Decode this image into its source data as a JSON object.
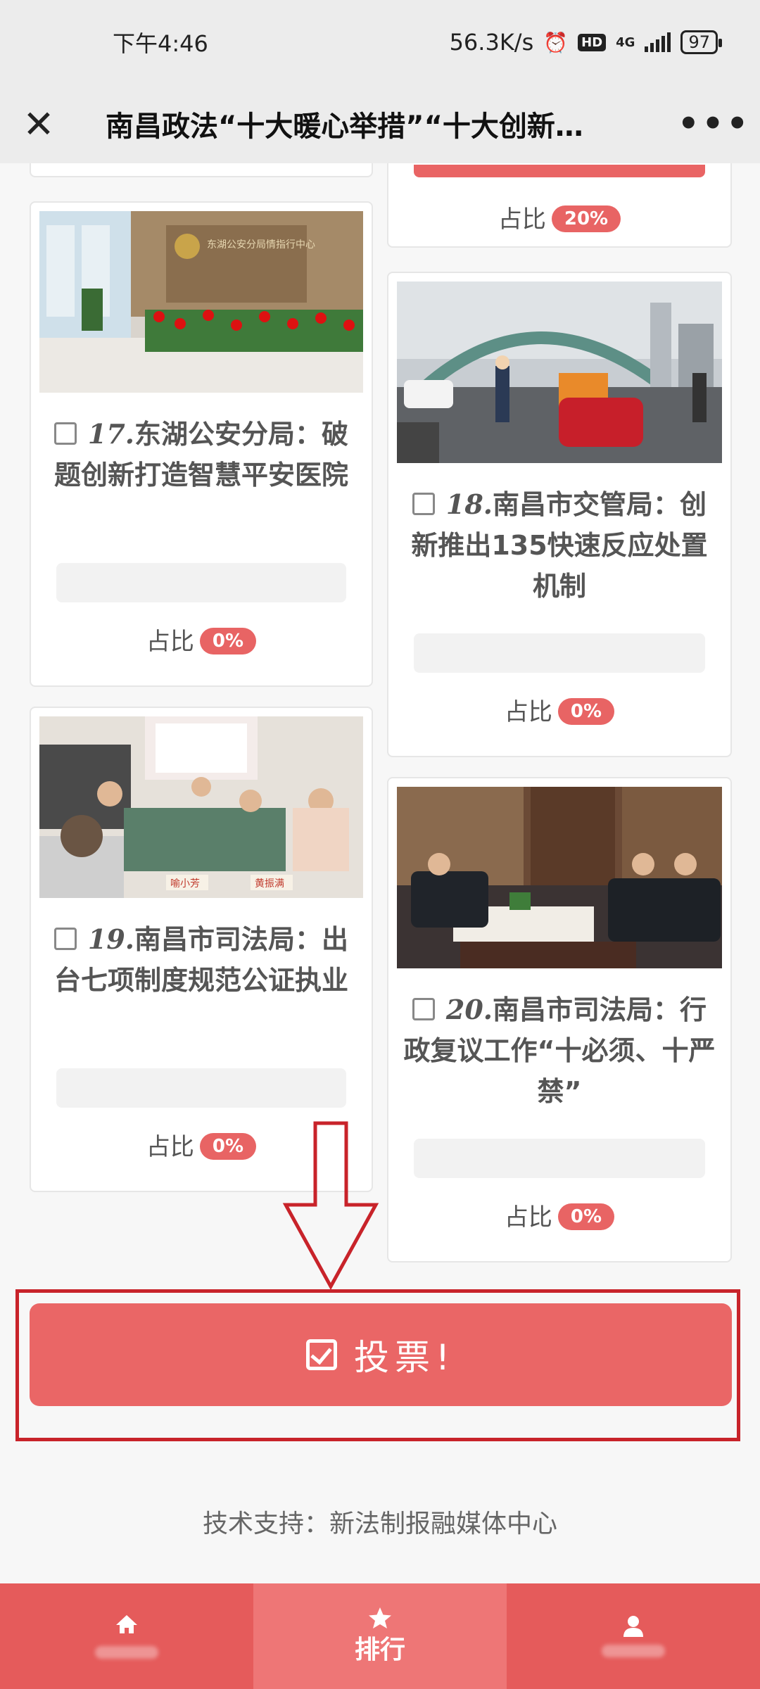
{
  "status_bar": {
    "time": "下午4:46",
    "net_speed": "56.3K/s",
    "hd": "HD",
    "network": "4G",
    "battery": "97"
  },
  "title_bar": {
    "title": "南昌政法“十大暖心举措”“十大创新…",
    "more": "•••",
    "close": "✕"
  },
  "partial_top": {
    "label": "占比",
    "percent": "20%"
  },
  "cards": [
    {
      "num": "17.",
      "title": "东湖公安分局：破题创新打造智慧平安医院",
      "label": "占比",
      "percent": "0%",
      "fill": 0,
      "sign_text": "东湖公安分局情指行中心"
    },
    {
      "num": "18.",
      "title": "南昌市交管局：创新推出135快速反应处置机制",
      "label": "占比",
      "percent": "0%",
      "fill": 0
    },
    {
      "num": "19.",
      "title": "南昌市司法局：出台七项制度规范公证执业",
      "label": "占比",
      "percent": "0%",
      "fill": 0,
      "nameplate_1": "喻小芳",
      "nameplate_2": "黄振满"
    },
    {
      "num": "20.",
      "title": "南昌市司法局：行政复议工作“十必须、十严禁”",
      "label": "占比",
      "percent": "0%",
      "fill": 0
    }
  ],
  "vote_button": {
    "label": "投票!"
  },
  "support_text": "技术支持：新法制报融媒体中心",
  "bottom_nav": {
    "home_icon": "home-icon",
    "rank_label": "排行",
    "me_icon": "user-icon"
  },
  "colors": {
    "accent": "#e96464",
    "highlight_border": "#c8232a"
  }
}
